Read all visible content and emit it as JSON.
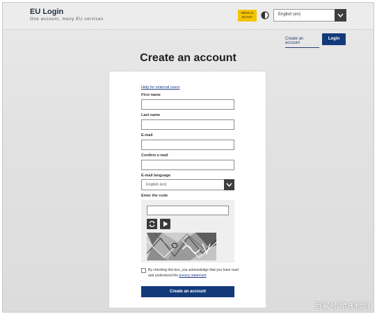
{
  "header": {
    "title": "EU Login",
    "subtitle": "One account, many EU services",
    "ecas_badge": "Where is ECAS?",
    "ecas_badge_lines": [
      "Where is",
      "ECAS?"
    ],
    "language": "English (en)",
    "create_account_link": "Create an account",
    "login_button": "Login"
  },
  "page": {
    "title": "Create an account"
  },
  "form": {
    "help_link": "Help for external users",
    "first_name_label": "First name",
    "last_name_label": "Last name",
    "email_label": "E-mail",
    "confirm_email_label": "Confirm e-mail",
    "email_language_label": "E-mail language",
    "email_language_value": "English (en)",
    "code_label": "Enter the code",
    "consent_text": "By checking this box, you acknowledge that you have read and understood the",
    "privacy_link": "privacy statement",
    "submit_button": "Create an account"
  },
  "watermark": "百家号/帝氏检测",
  "colors": {
    "primary": "#123a7a",
    "badge": "#f5c400",
    "background": "#e5e5e5"
  },
  "icons": {
    "contrast": "half-circle-icon",
    "dropdown": "chevron-down-icon",
    "refresh": "refresh-icon",
    "audio": "play-icon"
  }
}
